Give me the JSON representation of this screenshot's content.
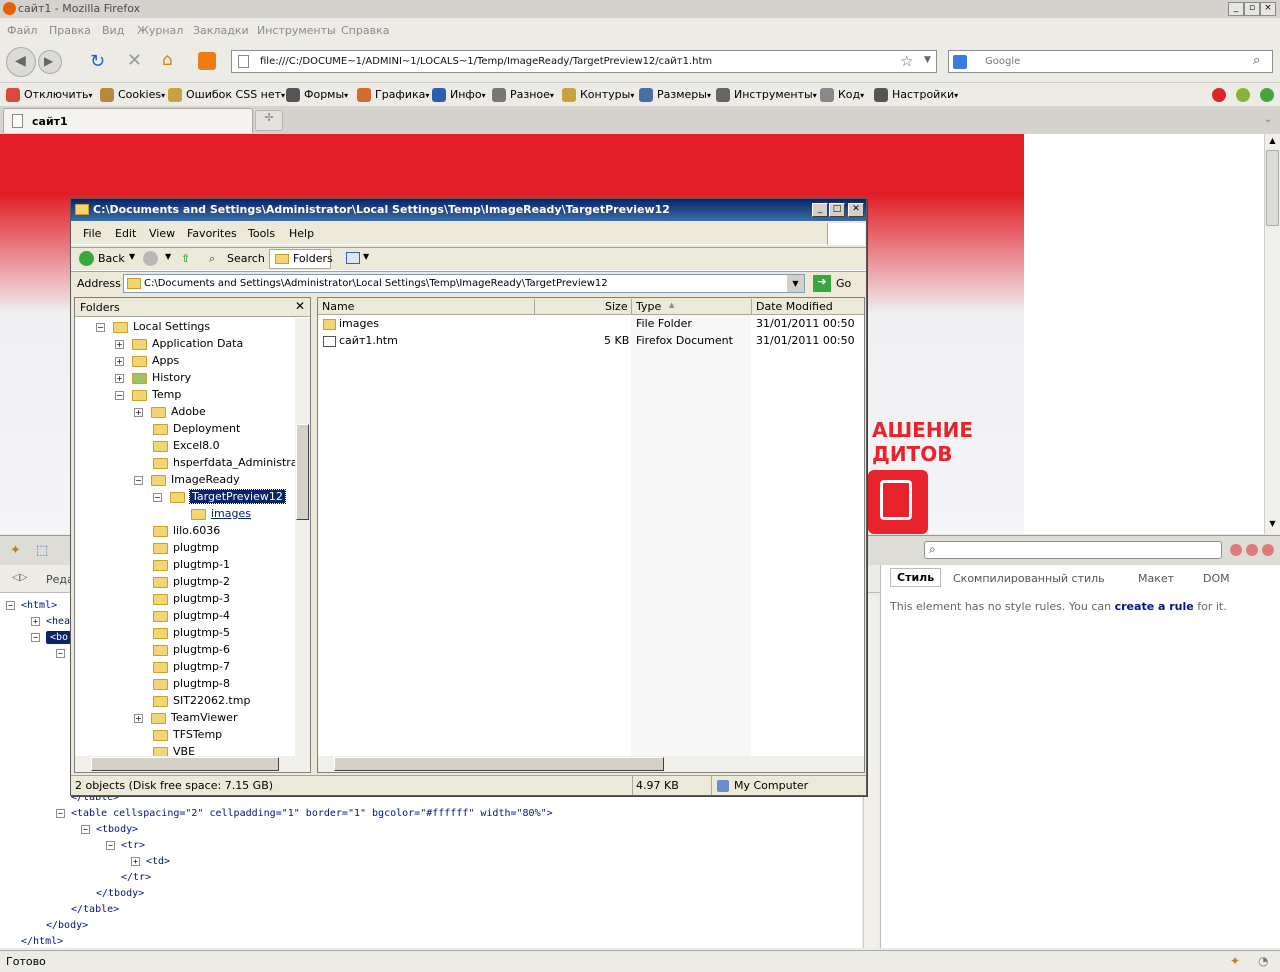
{
  "browser": {
    "window_title": "сайт1 - Mozilla Firefox",
    "menu": [
      "Файл",
      "Правка",
      "Вид",
      "Журнал",
      "Закладки",
      "Инструменты",
      "Справка"
    ],
    "url": "file:///C:/DOCUME~1/ADMINI~1/LOCALS~1/Temp/ImageReady/TargetPreview12/сайт1.htm",
    "search_placeholder": "Google",
    "webdev_toolbar": [
      "Отключить",
      "Cookies",
      "Ошибок CSS нет",
      "Формы",
      "Графика",
      "Инфо",
      "Разное",
      "Контуры",
      "Размеры",
      "Инструменты",
      "Код",
      "Настройки"
    ],
    "tab_label": "сайт1",
    "status": "Готово"
  },
  "page": {
    "promo_line1": "АШЕНИЕ",
    "promo_line2": "ДИТОВ"
  },
  "firebug": {
    "panel_tab_partial": "Реда",
    "side_tabs": [
      "Стиль",
      "Скомпилированный стиль",
      "Макет",
      "DOM"
    ],
    "msg_before": "This element has no style rules. You can ",
    "msg_link": "create a rule",
    "msg_after": " for it.",
    "html_lines": [
      {
        "indent": 0,
        "text": "<html>",
        "toggle": "−"
      },
      {
        "indent": 1,
        "text": "<hea",
        "toggle": "+"
      },
      {
        "indent": 1,
        "text": "<bo",
        "toggle": "−",
        "selected": true
      },
      {
        "indent": 2,
        "text": "",
        "toggle": "−"
      },
      {
        "indent": 2,
        "text": "</table>",
        "toggle": ""
      },
      {
        "indent": 2,
        "text": "<table cellspacing=\"2\" cellpadding=\"1\" border=\"1\" bgcolor=\"#ffffff\" width=\"80%\">",
        "toggle": "−"
      },
      {
        "indent": 3,
        "text": "<tbody>",
        "toggle": "−"
      },
      {
        "indent": 4,
        "text": "<tr>",
        "toggle": "−"
      },
      {
        "indent": 5,
        "text": "<td>",
        "toggle": "+"
      },
      {
        "indent": 4,
        "text": "</tr>",
        "toggle": ""
      },
      {
        "indent": 3,
        "text": "</tbody>",
        "toggle": ""
      },
      {
        "indent": 2,
        "text": "</table>",
        "toggle": ""
      },
      {
        "indent": 1,
        "text": "</body>",
        "toggle": ""
      },
      {
        "indent": 0,
        "text": "</html>",
        "toggle": ""
      }
    ]
  },
  "explorer": {
    "title": "C:\\Documents and Settings\\Administrator\\Local Settings\\Temp\\ImageReady\\TargetPreview12",
    "menu": [
      "File",
      "Edit",
      "View",
      "Favorites",
      "Tools",
      "Help"
    ],
    "toolbar": {
      "back": "Back",
      "search": "Search",
      "folders": "Folders"
    },
    "address_label": "Address",
    "address": "C:\\Documents and Settings\\Administrator\\Local Settings\\Temp\\ImageReady\\TargetPreview12",
    "go": "Go",
    "folders_title": "Folders",
    "tree": [
      {
        "label": "Local Settings",
        "level": 1,
        "toggle": "−"
      },
      {
        "label": "Application Data",
        "level": 2,
        "toggle": "+"
      },
      {
        "label": "Apps",
        "level": 2,
        "toggle": "+"
      },
      {
        "label": "History",
        "level": 2,
        "toggle": "+"
      },
      {
        "label": "Temp",
        "level": 2,
        "toggle": "−"
      },
      {
        "label": "Adobe",
        "level": 3,
        "toggle": "+"
      },
      {
        "label": "Deployment",
        "level": 3,
        "toggle": ""
      },
      {
        "label": "Excel8.0",
        "level": 3,
        "toggle": ""
      },
      {
        "label": "hsperfdata_Administrator",
        "level": 3,
        "toggle": ""
      },
      {
        "label": "ImageReady",
        "level": 3,
        "toggle": "−"
      },
      {
        "label": "TargetPreview12",
        "level": 4,
        "toggle": "−",
        "selected": true
      },
      {
        "label": "images",
        "level": 5,
        "toggle": "",
        "hover": true
      },
      {
        "label": "lilo.6036",
        "level": 3,
        "toggle": ""
      },
      {
        "label": "plugtmp",
        "level": 3,
        "toggle": ""
      },
      {
        "label": "plugtmp-1",
        "level": 3,
        "toggle": ""
      },
      {
        "label": "plugtmp-2",
        "level": 3,
        "toggle": ""
      },
      {
        "label": "plugtmp-3",
        "level": 3,
        "toggle": ""
      },
      {
        "label": "plugtmp-4",
        "level": 3,
        "toggle": ""
      },
      {
        "label": "plugtmp-5",
        "level": 3,
        "toggle": ""
      },
      {
        "label": "plugtmp-6",
        "level": 3,
        "toggle": ""
      },
      {
        "label": "plugtmp-7",
        "level": 3,
        "toggle": ""
      },
      {
        "label": "plugtmp-8",
        "level": 3,
        "toggle": ""
      },
      {
        "label": "SIT22062.tmp",
        "level": 3,
        "toggle": ""
      },
      {
        "label": "TeamViewer",
        "level": 3,
        "toggle": "+"
      },
      {
        "label": "TFSTemp",
        "level": 3,
        "toggle": ""
      },
      {
        "label": "VBE",
        "level": 3,
        "toggle": ""
      }
    ],
    "columns": [
      "Name",
      "Size",
      "Type",
      "Date Modified"
    ],
    "files": [
      {
        "name": "images",
        "size": "",
        "type": "File Folder",
        "date": "31/01/2011 00:50",
        "icon": "folder"
      },
      {
        "name": "сайт1.htm",
        "size": "5 KB",
        "type": "Firefox Document",
        "date": "31/01/2011 00:50",
        "icon": "document"
      }
    ],
    "status_left": "2 objects (Disk free space: 7.15 GB)",
    "status_size": "4.97 KB",
    "status_zone": "My Computer"
  }
}
